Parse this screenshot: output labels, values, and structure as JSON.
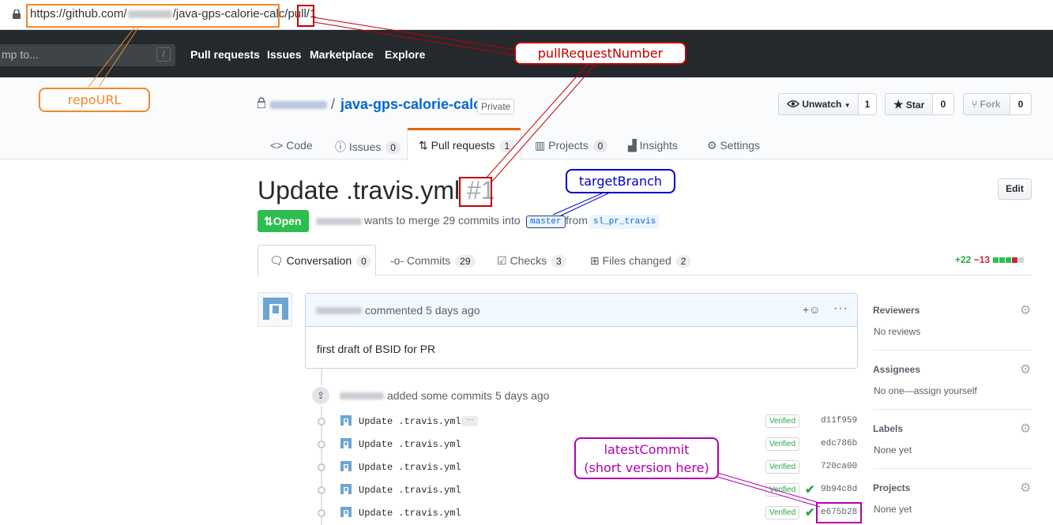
{
  "browser": {
    "url_prefix": "https://github.com/",
    "url_suffix": "/java-gps-calorie-calc/pull/1"
  },
  "header": {
    "jump_placeholder": "mp to...",
    "jump_shortcut": "/",
    "nav": [
      "Pull requests",
      "Issues",
      "Marketplace",
      "Explore"
    ]
  },
  "repo": {
    "separator": "/",
    "name": "java-gps-calorie-calc",
    "visibility": "Private",
    "unwatch_label": "Unwatch",
    "watch_count": "1",
    "star_label": "Star",
    "star_count": "0",
    "fork_label": "Fork",
    "fork_count": "0"
  },
  "repo_nav": {
    "code": "Code",
    "issues": "Issues",
    "issues_count": "0",
    "pulls": "Pull requests",
    "pulls_count": "1",
    "projects": "Projects",
    "projects_count": "0",
    "insights": "Insights",
    "settings": "Settings"
  },
  "pr": {
    "title": "Update .travis.yml",
    "number": "#1",
    "edit_label": "Edit",
    "state": "Open",
    "meta_text": "wants to merge 29 commits into",
    "target_branch": "master",
    "from_text": "from",
    "source_branch": "sl_pr_travis"
  },
  "pr_tabs": {
    "conversation": "Conversation",
    "conversation_count": "0",
    "commits": "Commits",
    "commits_count": "29",
    "checks": "Checks",
    "checks_count": "3",
    "files": "Files changed",
    "files_count": "2",
    "additions": "+22",
    "deletions": "−13"
  },
  "comment": {
    "meta": "commented 5 days ago",
    "body": "first draft of BSID for PR",
    "react_icon": "smiley-icon",
    "more_icon": "kebab-icon"
  },
  "timeline": {
    "push_meta": "added some commits 5 days ago",
    "commits": [
      {
        "msg": "Update .travis.yml",
        "badge": "Verified",
        "sha": "d11f959"
      },
      {
        "msg": "Update .travis.yml",
        "badge": "Verified",
        "sha": "edc786b"
      },
      {
        "msg": "Update .travis.yml",
        "badge": "Verified",
        "sha": "720ca00"
      },
      {
        "msg": "Update .travis.yml",
        "badge": "Verified",
        "sha": "9b94c8d"
      },
      {
        "msg": "Update .travis.yml",
        "badge": "Verified",
        "sha": "e675b28"
      }
    ]
  },
  "sidebar": {
    "reviewers": "Reviewers",
    "reviewers_val": "No reviews",
    "assignees": "Assignees",
    "assignees_val": "No one—assign yourself",
    "labels": "Labels",
    "labels_val": "None yet",
    "projects": "Projects",
    "projects_val": "None yet"
  },
  "annotations": {
    "repo_url": "repoURL",
    "pull_number": "pullRequestNumber",
    "target_branch": "targetBranch",
    "latest_commit_1": "latestCommit",
    "latest_commit_2": "(short version here)"
  },
  "colors": {
    "orange": "#f0892a",
    "red": "#c00000",
    "blue": "#0000cc",
    "purple": "#b000b0",
    "open_green": "#2cbe4e",
    "link_blue": "#0366d6"
  }
}
